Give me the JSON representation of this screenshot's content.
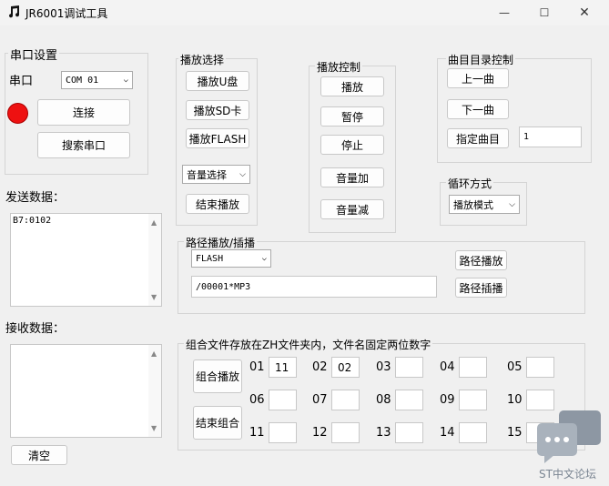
{
  "window": {
    "title": "JR6001调试工具",
    "icon": "music-note-icon",
    "controls": {
      "minimize": "—",
      "maximize": "☐",
      "close": "✕"
    }
  },
  "serial": {
    "group_label": "串口设置",
    "port_label": "串口",
    "port_value": "COM 01",
    "status_color": "#ee1111",
    "connect_label": "连接",
    "search_label": "搜索串口"
  },
  "send": {
    "label": "发送数据：",
    "value": "B7:0102"
  },
  "receive": {
    "label": "接收数据：",
    "value": ""
  },
  "clear_label": "清空",
  "play_select": {
    "group_label": "播放选择",
    "udisk": "播放U盘",
    "sd": "播放SD卡",
    "flash": "播放FLASH",
    "volume_select": "音量选择",
    "stop_play": "结束播放"
  },
  "play_control": {
    "group_label": "播放控制",
    "play": "播放",
    "pause": "暂停",
    "stop": "停止",
    "vol_up": "音量加",
    "vol_down": "音量减"
  },
  "track": {
    "group_label": "曲目目录控制",
    "prev": "上一曲",
    "next": "下一曲",
    "specify": "指定曲目",
    "specify_value": "1"
  },
  "loop": {
    "group_label": "循环方式",
    "mode": "播放模式"
  },
  "path": {
    "group_label": "路径播放/插播",
    "device": "FLASH",
    "path_value": "/00001*MP3",
    "play_btn": "路径播放",
    "insert_btn": "路径插播"
  },
  "combo": {
    "group_label": "组合文件存放在ZH文件夹内，文件名固定两位数字",
    "play_btn": "组合播放",
    "stop_btn": "结束组合",
    "slots": [
      {
        "num": "01",
        "value": "11"
      },
      {
        "num": "02",
        "value": "02"
      },
      {
        "num": "03",
        "value": ""
      },
      {
        "num": "04",
        "value": ""
      },
      {
        "num": "05",
        "value": ""
      },
      {
        "num": "06",
        "value": ""
      },
      {
        "num": "07",
        "value": ""
      },
      {
        "num": "08",
        "value": ""
      },
      {
        "num": "09",
        "value": ""
      },
      {
        "num": "10",
        "value": ""
      },
      {
        "num": "11",
        "value": ""
      },
      {
        "num": "12",
        "value": ""
      },
      {
        "num": "13",
        "value": ""
      },
      {
        "num": "14",
        "value": ""
      },
      {
        "num": "15",
        "value": ""
      }
    ]
  },
  "watermark": {
    "text": "ST中文论坛"
  }
}
